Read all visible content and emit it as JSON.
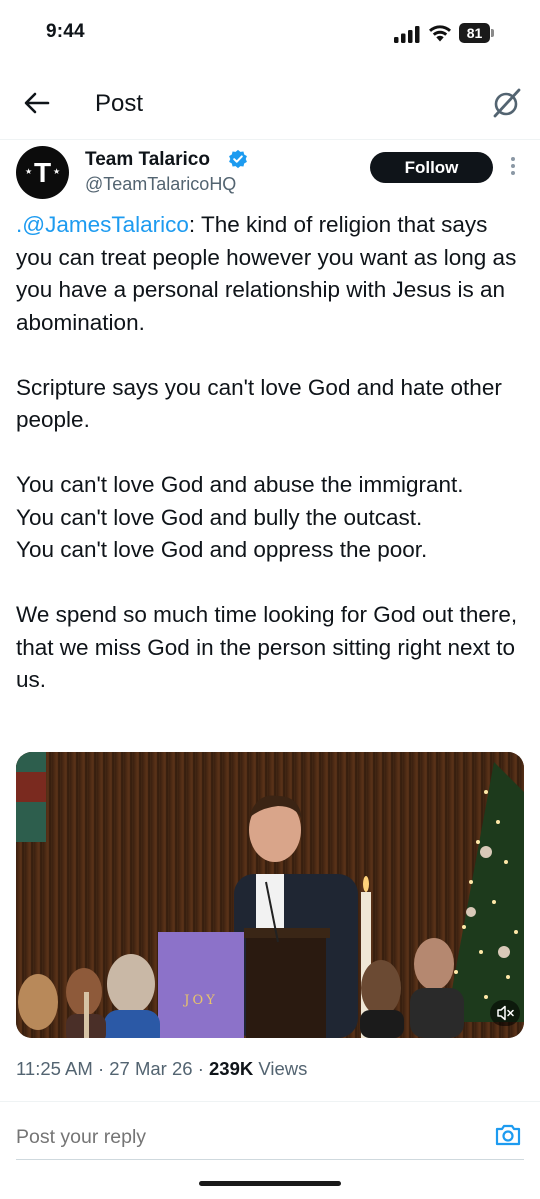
{
  "status_bar": {
    "time": "9:44",
    "battery": "81"
  },
  "header": {
    "title": "Post"
  },
  "author": {
    "avatar_letter": "T",
    "display_name": "Team Talarico",
    "handle": "@TeamTalaricoHQ",
    "follow_label": "Follow"
  },
  "tweet": {
    "mention": ".@JamesTalarico",
    "lines": [
      ": The kind of religion that says you can treat people however you want as long as you have a personal relationship with Jesus is an abomination.",
      "Scripture says you can't love God and hate other people.",
      "You can't love God and abuse the immigrant.",
      "You can't love God and bully the outcast.",
      "You can't love God and oppress the poor.",
      "We spend so much time looking for God out there, that we miss God in the person sitting right next to us."
    ]
  },
  "media": {
    "banner_text": "JOY"
  },
  "meta": {
    "time": "11:25 AM",
    "date": "27 Mar 26",
    "separator": "·",
    "views_count": "239K",
    "views_label": "Views"
  },
  "reply": {
    "placeholder": "Post your reply"
  },
  "colors": {
    "accent": "#1d9bf0",
    "text": "#0f1419",
    "muted": "#536471"
  },
  "icons": [
    "back-arrow-icon",
    "grok-icon",
    "verified-badge-icon",
    "more-icon",
    "mute-icon",
    "camera-icon",
    "signal-icon",
    "wifi-icon",
    "battery-icon"
  ]
}
